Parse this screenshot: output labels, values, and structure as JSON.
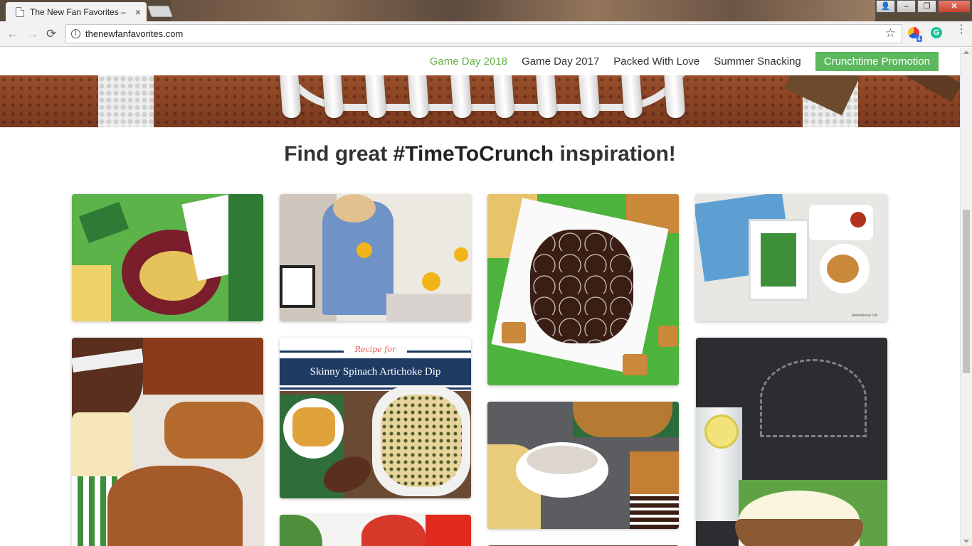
{
  "browser": {
    "tab_title": "The New Fan Favorites –",
    "tab_close": "×",
    "url": "thenewfanfavorites.com",
    "info_glyph": "i",
    "star_glyph": "☆",
    "back_glyph": "←",
    "forward_glyph": "→",
    "reload_glyph": "⟳",
    "ext_badge": "4",
    "ext2_letter": "G",
    "menu_glyph": "⋮",
    "win_min": "–",
    "win_restore": "❐",
    "win_close": "✕",
    "win_user": "👤"
  },
  "nav": {
    "items": [
      {
        "label": "Game Day 2018",
        "active": true
      },
      {
        "label": "Game Day 2017",
        "active": false
      },
      {
        "label": "Packed With Love",
        "active": false
      },
      {
        "label": "Summer Snacking",
        "active": false
      }
    ],
    "cta_label": "Crunchtime Promotion",
    "accent_color": "#6ab04c",
    "cta_color": "#5cb85c"
  },
  "headline": {
    "prefix": "Find great ",
    "hashtag": "#TimeToCrunch",
    "suffix": " inspiration!"
  },
  "grid": {
    "recipe_card": {
      "recipe_for": "Recipe for",
      "title": "Skinny Spinach Artichoke Dip"
    },
    "tray_caption": "Relentlessly Life",
    "images": [
      "snack-platter-photo",
      "woman-sunflowers-photo",
      "chocolate-footballs-photo",
      "snack-tray-photo",
      "pretzels-popcorn-cashews-photo",
      "spinach-artichoke-dip-photo",
      "chips-and-dip-photo",
      "chalkboard-popcorn-lemonade-photo",
      "tomatoes-photo"
    ]
  }
}
